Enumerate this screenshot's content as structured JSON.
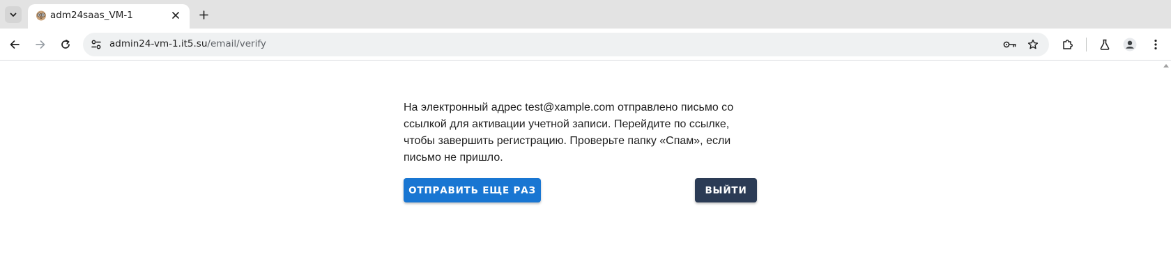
{
  "browser": {
    "tab": {
      "title": "adm24saas_VM-1"
    },
    "address_bar": {
      "host": "admin24-vm-1.it5.su",
      "path": "/email/verify"
    },
    "icons": {
      "tab_search": "chevron-down-icon",
      "favicon": "owl-face-icon",
      "tab_close": "close-icon",
      "new_tab": "plus-icon",
      "back": "arrow-left-icon",
      "forward": "arrow-right-icon",
      "reload": "reload-icon",
      "site_info": "tune-icon",
      "password_key": "key-icon",
      "bookmark": "star-icon",
      "extensions": "puzzle-icon",
      "labs": "flask-icon",
      "profile": "person-icon",
      "menu": "kebab-menu-icon"
    }
  },
  "page": {
    "message": "На электронный адрес test@xample.com отправлено письмо со ссылкой для активации учетной записи. Перейдите по ссылке, чтобы завершить регистрацию. Проверьте папку «Спам», если письмо не пришло.",
    "resend_button": "Отправить еще раз",
    "logout_button": "Выйти"
  },
  "colors": {
    "primary": "#1976d2",
    "secondary": "#2b3b55",
    "tabstrip": "#e3e3e3",
    "omnibox": "#eff1f2"
  }
}
